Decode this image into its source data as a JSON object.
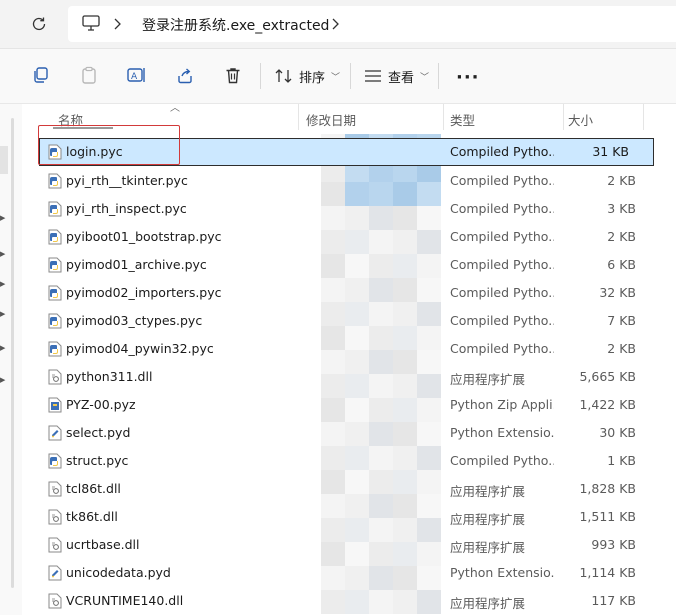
{
  "address": {
    "path": "登录注册系统.exe_extracted"
  },
  "toolbar": {
    "sort_label": "排序",
    "view_label": "查看",
    "more_label": "···"
  },
  "columns": {
    "name": "名称",
    "date": "修改日期",
    "type": "类型",
    "size": "大小"
  },
  "files": [
    {
      "name": "login.pyc",
      "type": "Compiled Pytho...",
      "size": "31 KB",
      "icon": "python-file-icon",
      "selected": true
    },
    {
      "name": "pyi_rth__tkinter.pyc",
      "type": "Compiled Pytho...",
      "size": "2 KB",
      "icon": "python-file-icon"
    },
    {
      "name": "pyi_rth_inspect.pyc",
      "type": "Compiled Pytho...",
      "size": "3 KB",
      "icon": "python-file-icon"
    },
    {
      "name": "pyiboot01_bootstrap.pyc",
      "type": "Compiled Pytho...",
      "size": "2 KB",
      "icon": "python-file-icon"
    },
    {
      "name": "pyimod01_archive.pyc",
      "type": "Compiled Pytho...",
      "size": "6 KB",
      "icon": "python-file-icon"
    },
    {
      "name": "pyimod02_importers.pyc",
      "type": "Compiled Pytho...",
      "size": "32 KB",
      "icon": "python-file-icon"
    },
    {
      "name": "pyimod03_ctypes.pyc",
      "type": "Compiled Pytho...",
      "size": "7 KB",
      "icon": "python-file-icon"
    },
    {
      "name": "pyimod04_pywin32.pyc",
      "type": "Compiled Pytho...",
      "size": "2 KB",
      "icon": "python-file-icon"
    },
    {
      "name": "python311.dll",
      "type": "应用程序扩展",
      "size": "5,665 KB",
      "icon": "dll-file-icon"
    },
    {
      "name": "PYZ-00.pyz",
      "type": "Python Zip Appli...",
      "size": "1,422 KB",
      "icon": "pyz-file-icon"
    },
    {
      "name": "select.pyd",
      "type": "Python Extensio...",
      "size": "30 KB",
      "icon": "pyd-file-icon"
    },
    {
      "name": "struct.pyc",
      "type": "Compiled Pytho...",
      "size": "1 KB",
      "icon": "python-file-icon"
    },
    {
      "name": "tcl86t.dll",
      "type": "应用程序扩展",
      "size": "1,828 KB",
      "icon": "dll-file-icon"
    },
    {
      "name": "tk86t.dll",
      "type": "应用程序扩展",
      "size": "1,511 KB",
      "icon": "dll-file-icon"
    },
    {
      "name": "ucrtbase.dll",
      "type": "应用程序扩展",
      "size": "993 KB",
      "icon": "dll-file-icon"
    },
    {
      "name": "unicodedata.pyd",
      "type": "Python Extensio...",
      "size": "1,114 KB",
      "icon": "pyd-file-icon"
    },
    {
      "name": "VCRUNTIME140.dll",
      "type": "应用程序扩展",
      "size": "117 KB",
      "icon": "dll-file-icon"
    }
  ],
  "colors": {
    "selection": "#cce8ff",
    "highlight_box": "#d23a3a",
    "python_blue": "#3b6fb6",
    "python_yellow": "#f2c94c"
  }
}
